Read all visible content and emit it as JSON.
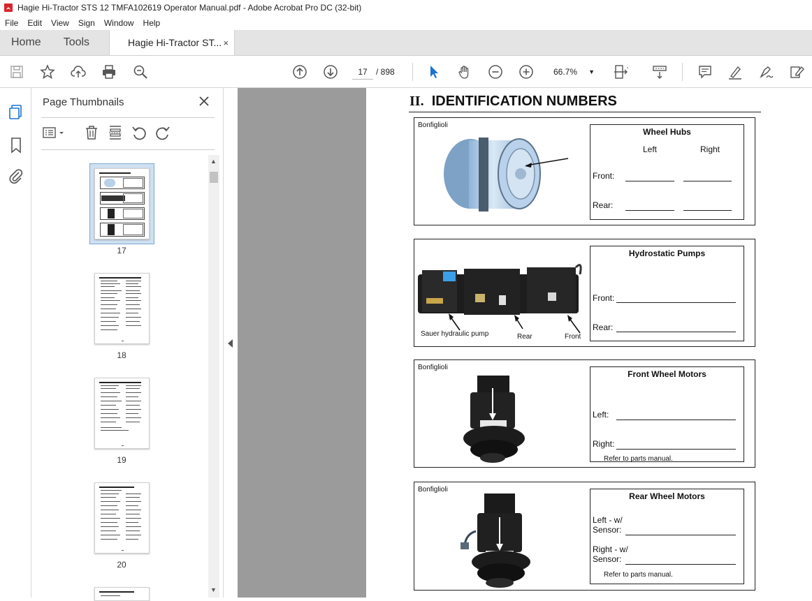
{
  "window": {
    "title": "Hagie Hi-Tractor STS 12 TMFA102619 Operator Manual.pdf - Adobe Acrobat Pro DC (32-bit)"
  },
  "menu": [
    "File",
    "Edit",
    "View",
    "Sign",
    "Window",
    "Help"
  ],
  "tabs": {
    "home": "Home",
    "tools": "Tools",
    "document": "Hagie Hi-Tractor ST...",
    "close": "×"
  },
  "toolbar": {
    "current_page": "17",
    "page_total": "/ 898",
    "zoom": "66.7%"
  },
  "panel": {
    "title": "Page Thumbnails",
    "thumbnails": [
      {
        "label": "17",
        "selected": true
      },
      {
        "label": "18",
        "selected": false
      },
      {
        "label": "19",
        "selected": false
      },
      {
        "label": "20",
        "selected": false
      }
    ]
  },
  "document": {
    "heading_roman": "II.",
    "heading_text": "IDENTIFICATION NUMBERS",
    "sections": {
      "wheel_hubs": {
        "brand": "Bonfiglioli",
        "title": "Wheel Hubs",
        "col_left": "Left",
        "col_right": "Right",
        "row1": "Front:",
        "row2": "Rear:"
      },
      "pumps": {
        "title": "Hydrostatic Pumps",
        "row1": "Front:",
        "row2": "Rear:",
        "caption_pump": "Sauer hydraulic pump",
        "caption_rear": "Rear",
        "caption_front": "Front"
      },
      "front_motors": {
        "brand": "Bonfiglioli",
        "title": "Front Wheel Motors",
        "row1": "Left:",
        "row2": "Right:",
        "note": "Refer to parts manual."
      },
      "rear_motors": {
        "brand": "Bonfiglioli",
        "title": "Rear Wheel Motors",
        "row1a": "Left - w/",
        "row1b": "Sensor:",
        "row2a": "Right - w/",
        "row2b": "Sensor:",
        "note": "Refer to parts manual."
      }
    }
  },
  "colors": {
    "accent": "#1a73d0",
    "doc_bg": "#9b9b9b",
    "pdf_red": "#d7252a"
  }
}
